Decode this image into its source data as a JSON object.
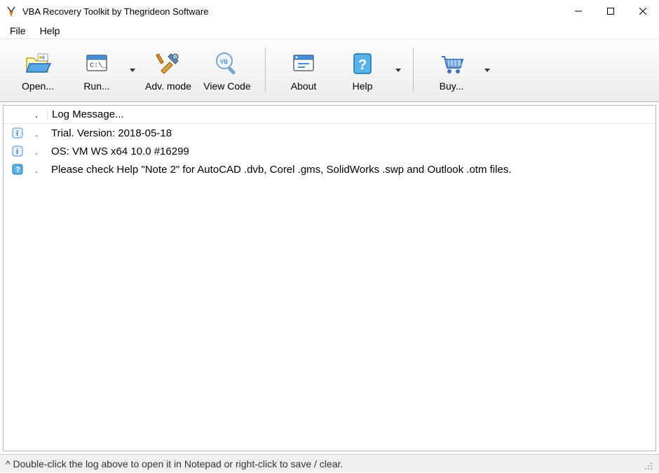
{
  "window": {
    "title": "VBA Recovery Toolkit by Thegrideon Software"
  },
  "menu": {
    "file": "File",
    "help": "Help"
  },
  "toolbar": {
    "open": "Open...",
    "run": "Run...",
    "adv": "Adv. mode",
    "view_code": "View Code",
    "about": "About",
    "help": "Help",
    "buy": "Buy..."
  },
  "log": {
    "header_dot": ".",
    "header_label": "Log Message...",
    "rows": [
      {
        "icon": "info",
        "dot": ".",
        "msg": "Trial. Version: 2018-05-18"
      },
      {
        "icon": "info",
        "dot": ".",
        "msg": "OS: VM WS x64 10.0 #16299"
      },
      {
        "icon": "help",
        "dot": ".",
        "msg": "Please check Help \"Note 2\" for AutoCAD .dvb, Corel .gms, SolidWorks .swp and Outlook .otm files."
      }
    ]
  },
  "status": {
    "text": "^ Double-click the log above to open it in Notepad or right-click to save / clear."
  }
}
